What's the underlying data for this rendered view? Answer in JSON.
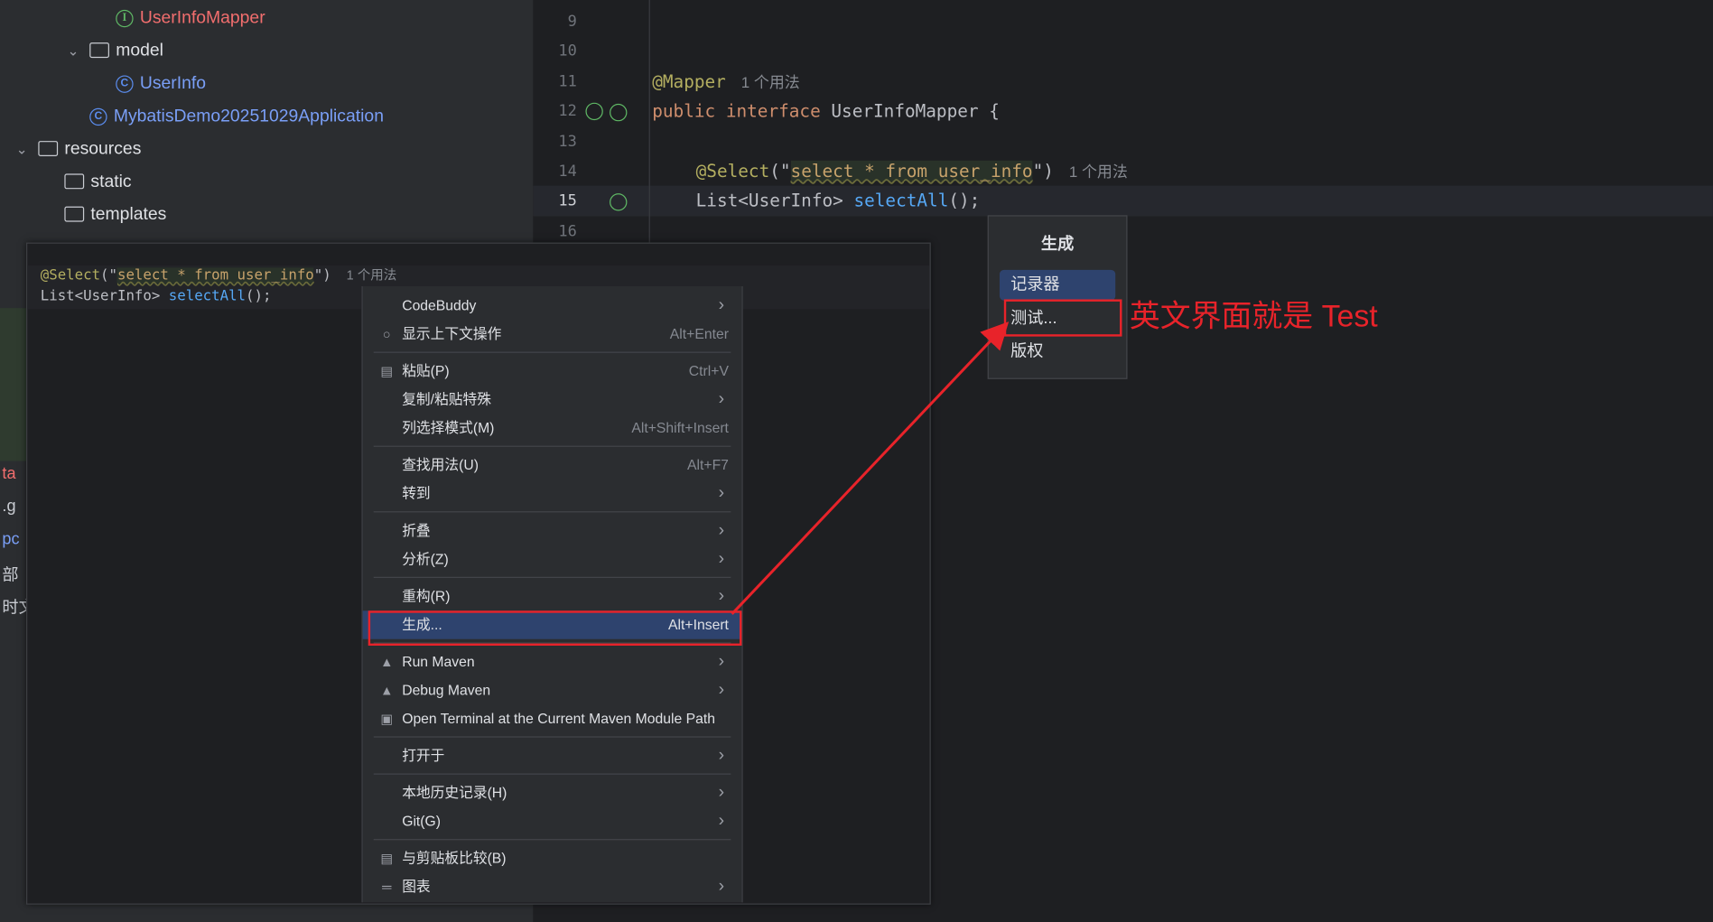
{
  "project_tree": {
    "items": [
      {
        "label": "UserInfoMapper",
        "kind": "interface"
      },
      {
        "label": "model",
        "kind": "package"
      },
      {
        "label": "UserInfo",
        "kind": "class"
      },
      {
        "label": "MybatisDemo20251029Application",
        "kind": "app-class"
      },
      {
        "label": "resources",
        "kind": "resources-folder"
      },
      {
        "label": "static",
        "kind": "folder"
      },
      {
        "label": "templates",
        "kind": "folder"
      }
    ],
    "fragments": [
      "ta",
      ".g",
      "pc",
      "部",
      "时文"
    ]
  },
  "editor": {
    "line_numbers": [
      "9",
      "10",
      "11",
      "12",
      "13",
      "14",
      "15",
      "16"
    ],
    "annotation_mapper": "@Mapper",
    "usage_hint": "1 个用法",
    "kw_public": "public",
    "kw_interface": "interface",
    "interface_name": "UserInfoMapper",
    "open_brace": "{",
    "annotation_select": "@Select",
    "paren_open": "(\"",
    "sql": "select * from user_info",
    "paren_close": "\")",
    "return_type": "List<UserInfo>",
    "method": "selectAll",
    "method_tail": "();"
  },
  "context_menu": {
    "groups": [
      [
        {
          "label": "CodeBuddy",
          "shortcut": "",
          "submenu": true,
          "icon": ""
        },
        {
          "label": "显示上下文操作",
          "shortcut": "Alt+Enter",
          "submenu": false,
          "icon": "lightbulb-icon"
        }
      ],
      [
        {
          "label": "粘贴(P)",
          "shortcut": "Ctrl+V",
          "submenu": false,
          "icon": "clipboard-icon"
        },
        {
          "label": "复制/粘贴特殊",
          "shortcut": "",
          "submenu": true,
          "icon": ""
        },
        {
          "label": "列选择模式(M)",
          "shortcut": "Alt+Shift+Insert",
          "submenu": false,
          "icon": ""
        }
      ],
      [
        {
          "label": "查找用法(U)",
          "shortcut": "Alt+F7",
          "submenu": false,
          "icon": ""
        },
        {
          "label": "转到",
          "shortcut": "",
          "submenu": true,
          "icon": ""
        }
      ],
      [
        {
          "label": "折叠",
          "shortcut": "",
          "submenu": true,
          "icon": ""
        },
        {
          "label": "分析(Z)",
          "shortcut": "",
          "submenu": true,
          "icon": ""
        }
      ],
      [
        {
          "label": "重构(R)",
          "shortcut": "",
          "submenu": true,
          "icon": ""
        },
        {
          "label": "生成...",
          "shortcut": "Alt+Insert",
          "submenu": false,
          "icon": "",
          "selected": true
        }
      ],
      [
        {
          "label": "Run Maven",
          "shortcut": "",
          "submenu": true,
          "icon": "maven-run-icon"
        },
        {
          "label": "Debug Maven",
          "shortcut": "",
          "submenu": true,
          "icon": "maven-debug-icon"
        },
        {
          "label": "Open Terminal at the Current Maven Module Path",
          "shortcut": "",
          "submenu": false,
          "icon": "terminal-icon"
        }
      ],
      [
        {
          "label": "打开于",
          "shortcut": "",
          "submenu": true,
          "icon": ""
        }
      ],
      [
        {
          "label": "本地历史记录(H)",
          "shortcut": "",
          "submenu": true,
          "icon": ""
        },
        {
          "label": "Git(G)",
          "shortcut": "",
          "submenu": true,
          "icon": ""
        }
      ],
      [
        {
          "label": "与剪贴板比较(B)",
          "shortcut": "",
          "submenu": false,
          "icon": "compare-icon"
        },
        {
          "label": "图表",
          "shortcut": "",
          "submenu": true,
          "icon": "diagram-icon"
        }
      ]
    ]
  },
  "generate_popup": {
    "title": "生成",
    "items": [
      {
        "label": "记录器",
        "selected": true
      },
      {
        "label": "测试...",
        "selected": false
      },
      {
        "label": "版权",
        "selected": false
      }
    ]
  },
  "annotation_note": "英文界面就是 Test",
  "colors": {
    "accent_red": "#e8232a",
    "selection_blue": "#2e436e",
    "editor_bg": "#1e1f22",
    "panel_bg": "#2b2d30"
  }
}
